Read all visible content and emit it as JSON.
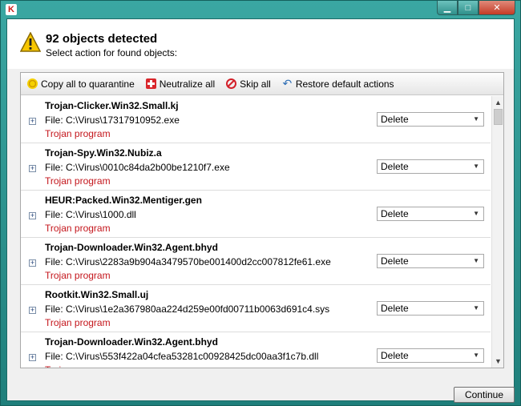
{
  "window": {
    "logo_letter": "K"
  },
  "header": {
    "title": "92 objects detected",
    "subtitle": "Select action for found objects:"
  },
  "toolbar": {
    "quarantine_label": "Copy all to quarantine",
    "neutralize_label": "Neutralize all",
    "skip_label": "Skip all",
    "restore_label": "Restore default actions"
  },
  "objects": [
    {
      "name": "Trojan-Clicker.Win32.Small.kj",
      "file": "File: C:\\Virus\\17317910952.exe",
      "type": "Trojan program",
      "action": "Delete"
    },
    {
      "name": "Trojan-Spy.Win32.Nubiz.a",
      "file": "File: C:\\Virus\\0010c84da2b00be1210f7.exe",
      "type": "Trojan program",
      "action": "Delete"
    },
    {
      "name": "HEUR:Packed.Win32.Mentiger.gen",
      "file": "File: C:\\Virus\\1000.dll",
      "type": "Trojan program",
      "action": "Delete"
    },
    {
      "name": "Trojan-Downloader.Win32.Agent.bhyd",
      "file": "File: C:\\Virus\\2283a9b904a3479570be001400d2cc007812fe61.exe",
      "type": "Trojan program",
      "action": "Delete"
    },
    {
      "name": "Rootkit.Win32.Small.uj",
      "file": "File: C:\\Virus\\1e2a367980aa224d259e00fd00711b0063d691c4.sys",
      "type": "Trojan program",
      "action": "Delete"
    },
    {
      "name": "Trojan-Downloader.Win32.Agent.bhyd",
      "file": "File: C:\\Virus\\553f422a04cfea53281c00928425dc00aa3f1c7b.dll",
      "type": "Trojan program",
      "action": "Delete"
    }
  ],
  "footer": {
    "continue_label": "Continue"
  },
  "colors": {
    "threat_type": "#c4161c",
    "window_frame": "#2a8a86"
  }
}
